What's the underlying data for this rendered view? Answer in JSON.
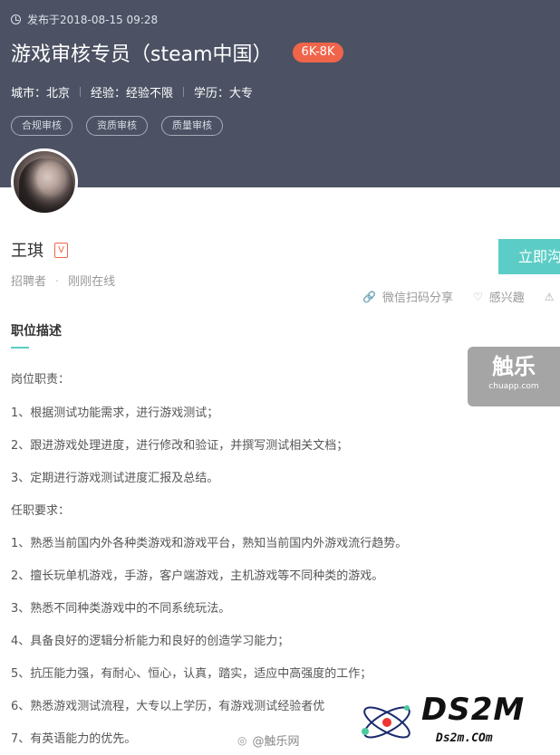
{
  "header": {
    "publish_date": "发布于2018-08-15 09:28",
    "job_title": "游戏审核专员（steam中国）",
    "salary": "6K-8K",
    "city": "城市：北京",
    "experience": "经验：经验不限",
    "education": "学历：大专",
    "tags": [
      "合规审核",
      "资质审核",
      "质量审核"
    ]
  },
  "recruiter": {
    "name": "王琪",
    "verified_badge": "V",
    "role": "招聘者",
    "status": "刚刚在线"
  },
  "apply_button": "立即沟通",
  "actions": {
    "share": "微信扫码分享",
    "interest": "感兴趣"
  },
  "section": {
    "title": "职位描述",
    "lines": [
      "岗位职责：",
      "1、根据测试功能需求，进行游戏测试；",
      "2、跟进游戏处理进度，进行修改和验证，并撰写测试相关文档；",
      "3、定期进行游戏测试进度汇报及总结。",
      "任职要求：",
      "1、熟悉当前国内外各种类游戏和游戏平台，熟知当前国内外游戏流行趋势。",
      "2、擅长玩单机游戏，手游，客户端游戏，主机游戏等不同种类的游戏。",
      "3、熟悉不同种类游戏中的不同系统玩法。",
      "4、具备良好的逻辑分析能力和良好的创造学习能力；",
      "5、抗压能力强，有耐心、恒心，认真，踏实，适应中高强度的工作；",
      "6、熟悉游戏测试流程，大专以上学历，有游戏测试经验者优",
      "7、有英语能力的优先。"
    ]
  },
  "watermarks": {
    "chuapp_main": "触乐",
    "chuapp_sub": "chuapp.com",
    "ds2m_big": "DS2M",
    "ds2m_small": "Ds2m.COm",
    "weibo": "@触乐网"
  },
  "colors": {
    "header_bg": "#4c5264",
    "accent": "#5ccdc6",
    "salary": "#f0654a"
  }
}
